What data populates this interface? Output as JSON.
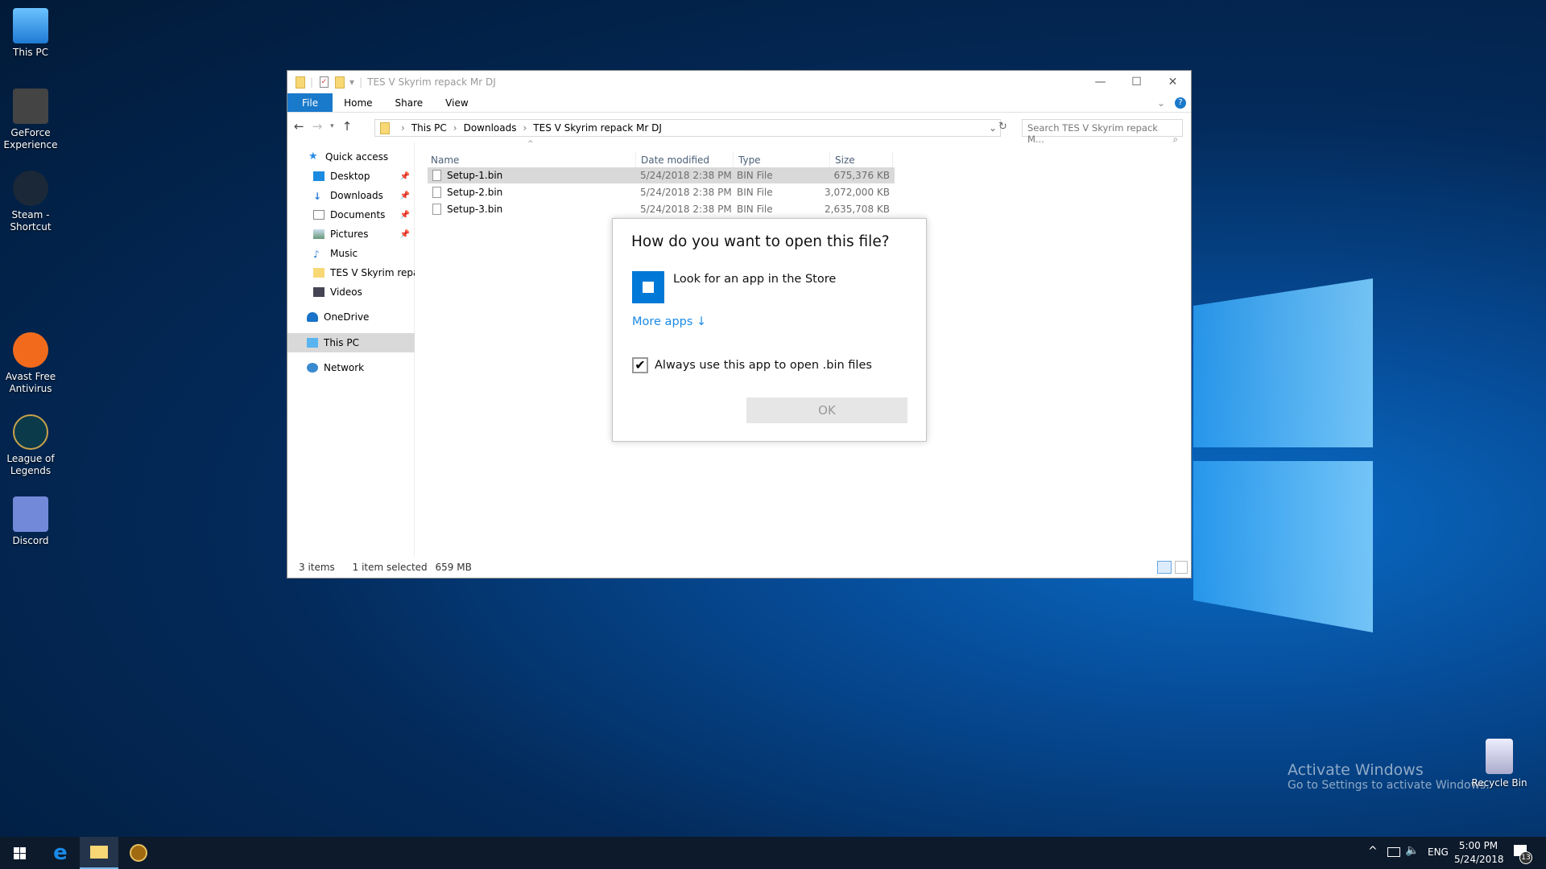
{
  "desktop": {
    "icons": [
      {
        "label": "This PC"
      },
      {
        "label": "GeForce Experience"
      },
      {
        "label": "Steam - Shortcut"
      },
      {
        "label": "Avast Free Antivirus"
      },
      {
        "label": "League of Legends"
      },
      {
        "label": "Discord"
      }
    ],
    "recycle_bin": "Recycle Bin",
    "activation": {
      "title": "Activate Windows",
      "subtitle": "Go to Settings to activate Windows."
    }
  },
  "explorer": {
    "title": "TES V Skyrim repack Mr DJ",
    "ribbon_tabs": [
      "File",
      "Home",
      "Share",
      "View"
    ],
    "breadcrumb": [
      "This PC",
      "Downloads",
      "TES V Skyrim repack Mr DJ"
    ],
    "search_placeholder": "Search TES V Skyrim repack M...",
    "nav": {
      "quick_access": "Quick access",
      "items": [
        {
          "label": "Desktop",
          "pinned": true
        },
        {
          "label": "Downloads",
          "pinned": true
        },
        {
          "label": "Documents",
          "pinned": true
        },
        {
          "label": "Pictures",
          "pinned": true
        },
        {
          "label": "Music"
        },
        {
          "label": "TES V Skyrim repack"
        },
        {
          "label": "Videos"
        }
      ],
      "onedrive": "OneDrive",
      "this_pc": "This PC",
      "network": "Network"
    },
    "columns": [
      "Name",
      "Date modified",
      "Type",
      "Size"
    ],
    "files": [
      {
        "name": "Setup-1.bin",
        "date": "5/24/2018 2:38 PM",
        "type": "BIN File",
        "size": "675,376 KB",
        "selected": true
      },
      {
        "name": "Setup-2.bin",
        "date": "5/24/2018 2:38 PM",
        "type": "BIN File",
        "size": "3,072,000 KB"
      },
      {
        "name": "Setup-3.bin",
        "date": "5/24/2018 2:38 PM",
        "type": "BIN File",
        "size": "2,635,708 KB"
      }
    ],
    "status": {
      "count": "3 items",
      "selection": "1 item selected",
      "size": "659 MB"
    }
  },
  "dialog": {
    "title": "How do you want to open this file?",
    "store_option": "Look for an app in the Store",
    "more_apps": "More apps",
    "always_use": "Always use this app to open .bin files",
    "always_checked": true,
    "ok": "OK"
  },
  "taskbar": {
    "language": "ENG",
    "time": "5:00 PM",
    "date": "5/24/2018",
    "notifications": "13"
  }
}
